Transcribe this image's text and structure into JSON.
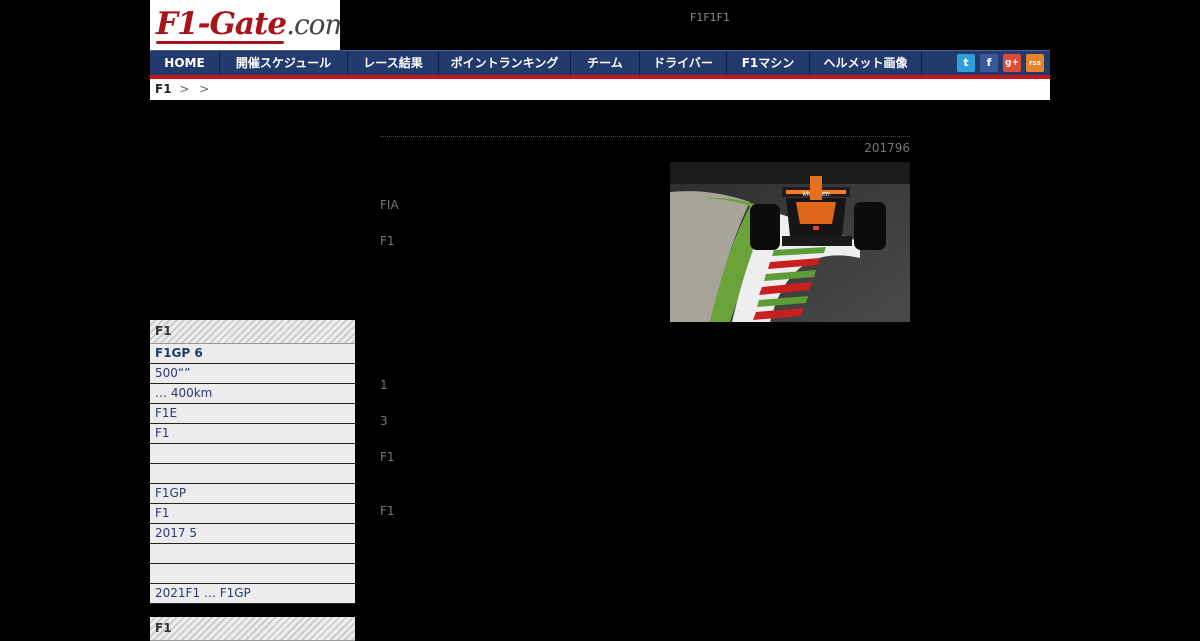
{
  "logo": {
    "primary": "F1",
    "rest": "-Gate",
    "domain": ".com"
  },
  "header_text": "F1F1F1",
  "nav": {
    "items": [
      "HOME",
      "開催スケジュール",
      "レース結果",
      "ポイントランキング",
      "チーム",
      "ドライバー",
      "F1マシン",
      "ヘルメット画像"
    ],
    "social": [
      "t",
      "f",
      "g+",
      "rss"
    ]
  },
  "breadcrumb": {
    "home": "F1",
    "sep1": ">",
    "sep2": ">"
  },
  "sidebar": {
    "box1": {
      "title": "F1",
      "items": [
        "F1GP 6",
        "500“”",
        " … 400km",
        "F1E",
        "F1",
        "",
        "",
        "F1GP",
        " F1",
        " 2017 5",
        "",
        "",
        "2021F1 … F1GP"
      ]
    },
    "box2": {
      "title": "F1"
    }
  },
  "article": {
    "date": "201796",
    "paragraphs": [
      "FIA",
      "F1",
      "1",
      "3",
      "F1",
      "F1"
    ]
  },
  "photo": {
    "car_badge": "McLaren"
  },
  "colors": {
    "nav_bg": "#223a6c",
    "nav_accent": "#c3161c",
    "logo_red": "#a8141a"
  }
}
